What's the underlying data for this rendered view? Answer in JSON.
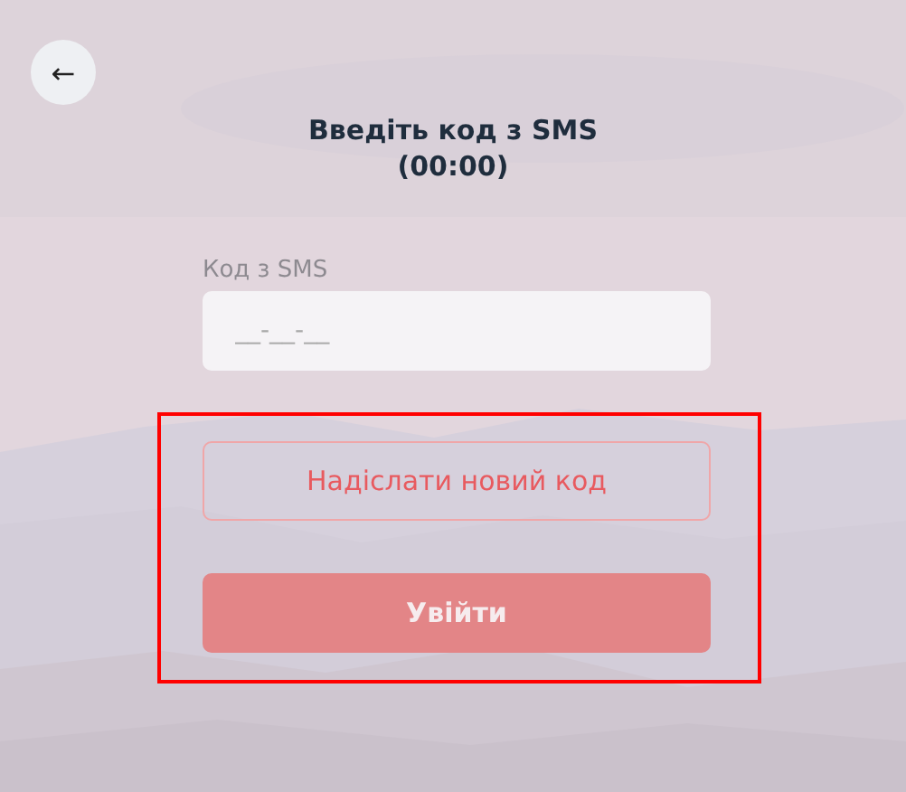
{
  "back_button": {
    "icon": "←"
  },
  "title": "Введіть код з SMS",
  "timer": "(00:00)",
  "code_field": {
    "label": "Код з SMS",
    "placeholder": "__-__-__"
  },
  "buttons": [
    {
      "kind": "outline",
      "label": "Надіслати новий код",
      "disabled": false
    },
    {
      "kind": "primary",
      "label": "Увійти",
      "disabled": true
    }
  ],
  "highlight": {
    "color": "#ff0000"
  }
}
